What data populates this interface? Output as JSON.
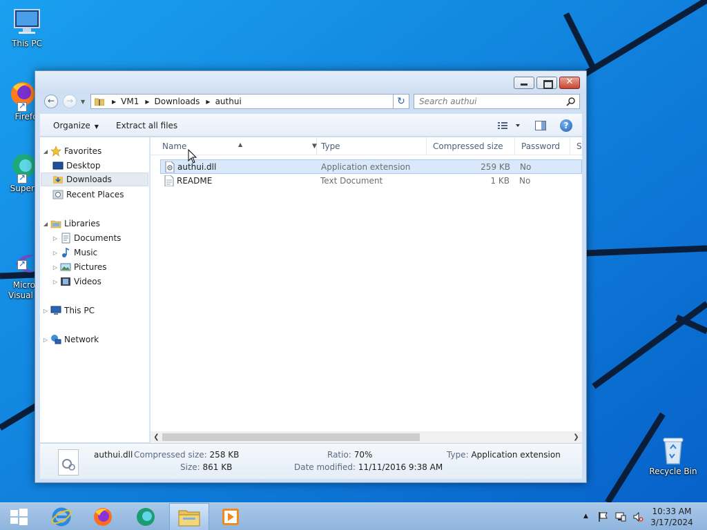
{
  "desktop": {
    "icons": [
      {
        "label": "This PC",
        "icon": "this-pc-icon"
      },
      {
        "label": "Firefo",
        "icon": "firefox-icon"
      },
      {
        "label": "Superm",
        "icon": "supermium-icon"
      },
      {
        "label": "Micros\nVisual St",
        "icon": "visual-studio-icon"
      },
      {
        "label": "Recycle Bin",
        "icon": "recycle-bin-icon"
      }
    ]
  },
  "window": {
    "breadcrumb": [
      "VM1",
      "Downloads",
      "authui"
    ],
    "search_placeholder": "Search authui",
    "toolbar": {
      "organize": "Organize",
      "extract_all": "Extract all files"
    },
    "nav_pane": {
      "favorites": "Favorites",
      "desktop": "Desktop",
      "downloads": "Downloads",
      "recent_places": "Recent Places",
      "libraries": "Libraries",
      "documents": "Documents",
      "music": "Music",
      "pictures": "Pictures",
      "videos": "Videos",
      "this_pc": "This PC",
      "network": "Network"
    },
    "columns": {
      "name": "Name",
      "type": "Type",
      "compressed_size": "Compressed size",
      "password": "Password ...",
      "size": "Si"
    },
    "files": [
      {
        "name": "authui.dll",
        "type": "Application extension",
        "compressed_size": "259 KB",
        "password": "No",
        "selected": true
      },
      {
        "name": "README",
        "type": "Text Document",
        "compressed_size": "1 KB",
        "password": "No",
        "selected": false
      }
    ],
    "details": {
      "name": "authui.dll",
      "compressed_size_label": "Compressed size:",
      "compressed_size": "258 KB",
      "size_label": "Size:",
      "size": "861 KB",
      "ratio_label": "Ratio:",
      "ratio": "70%",
      "date_label": "Date modified:",
      "date": "11/11/2016 9:38 AM",
      "type_label": "Type:",
      "type": "Application extension"
    }
  },
  "taskbar": {
    "time": "10:33 AM",
    "date": "3/17/2024"
  },
  "colors": {
    "wallpaper": "#0b76d6",
    "selection": "#d9e8fb",
    "taskbar": "#9ebfe4"
  }
}
